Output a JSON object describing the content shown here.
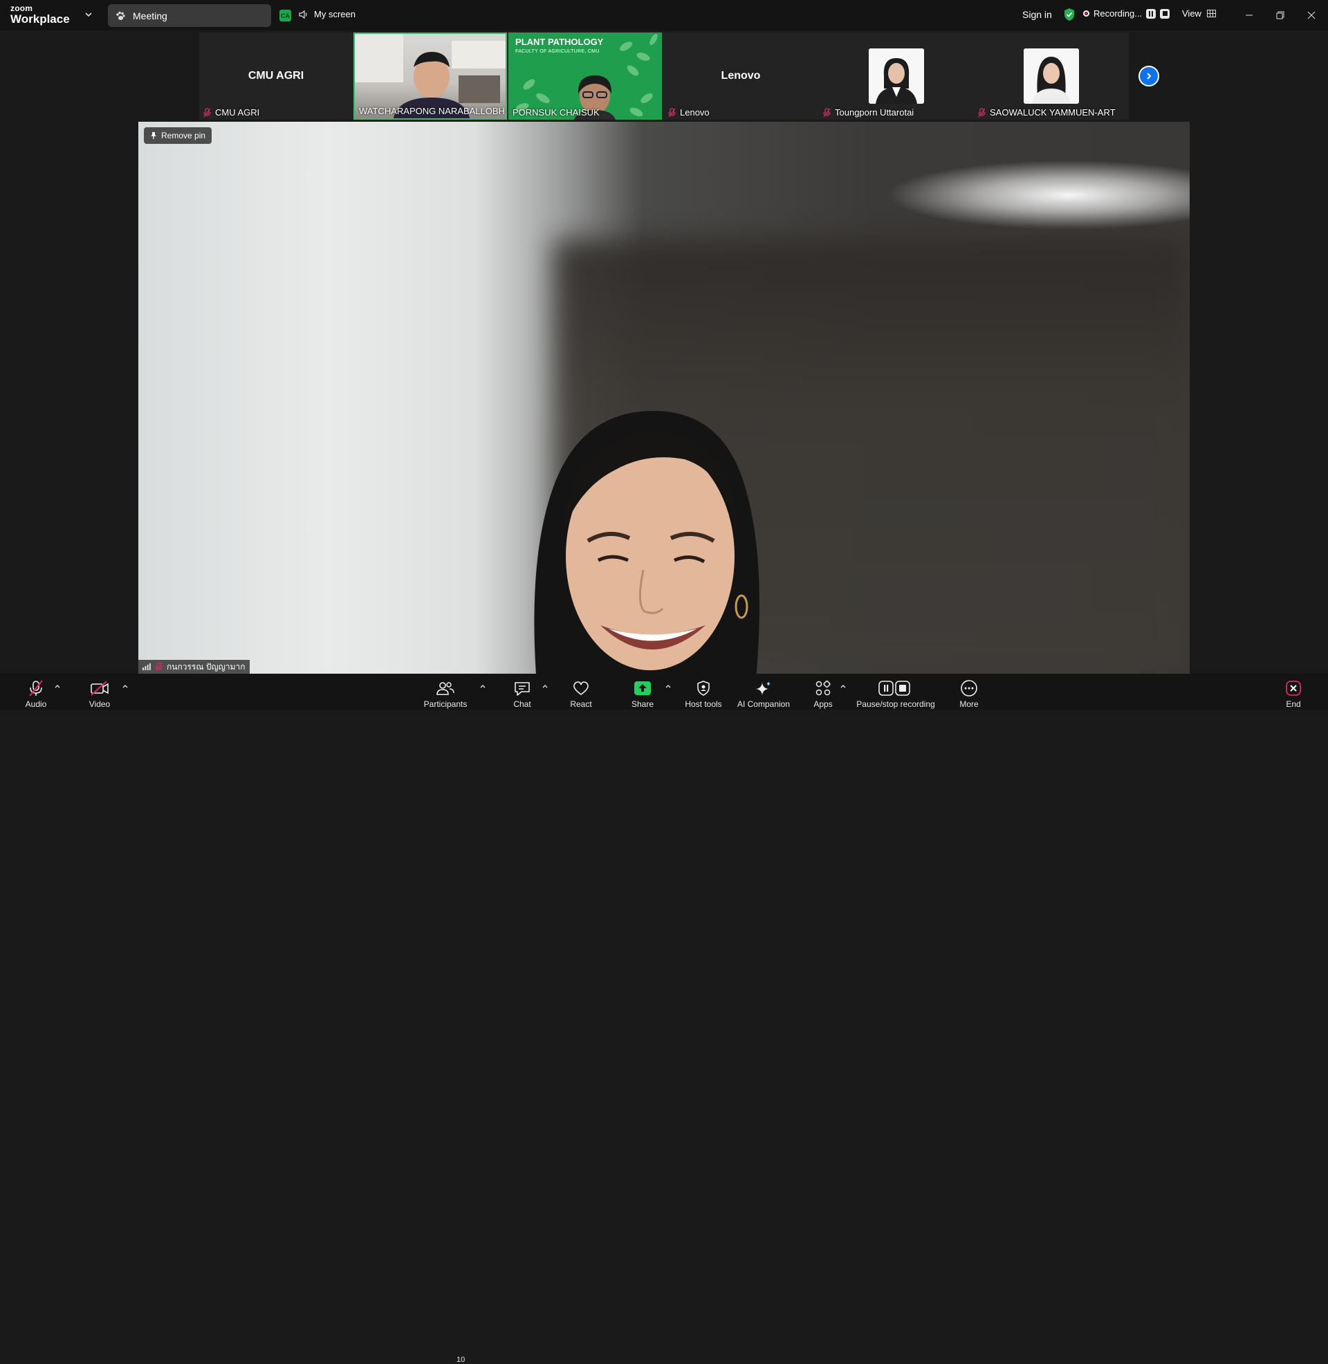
{
  "app": {
    "logo_small": "zoom",
    "logo_big": "Workplace"
  },
  "top": {
    "meeting_tab": "Meeting",
    "ca_badge": "CA",
    "my_screen": "My screen",
    "sign_in": "Sign in",
    "recording": "Recording...",
    "view": "View"
  },
  "participants_strip": [
    {
      "name": "CMU AGRI",
      "center": "CMU AGRI"
    },
    {
      "name": "WATCHARAPONG NARABALLOBH"
    },
    {
      "name": "PORNSUK CHAISUK",
      "banner_title": "PLANT PATHOLOGY",
      "banner_sub": "FACULTY OF AGRICULTURE, CMU"
    },
    {
      "name": "Lenovo",
      "center": "Lenovo"
    },
    {
      "name": "Toungporn Uttarotai"
    },
    {
      "name": "SAOWALUCK YAMMUEN-ART"
    }
  ],
  "main": {
    "remove_pin": "Remove pin",
    "speaker_name": "กนกวรรณ ปัญญามาก"
  },
  "toolbar": {
    "audio": "Audio",
    "video": "Video",
    "participants": "Participants",
    "participants_count": "10",
    "chat": "Chat",
    "react": "React",
    "share": "Share",
    "host_tools": "Host tools",
    "ai_companion": "AI Companion",
    "apps": "Apps",
    "pause_stop": "Pause/stop recording",
    "more": "More",
    "end": "End"
  },
  "colors": {
    "accent": "#0e72ed",
    "share": "#1fd15c",
    "active_speaker": "#27c66b",
    "end": "#e0245e",
    "muted": "#e0245e"
  },
  "icons": [
    "chevron-down-icon",
    "paw-icon",
    "speaker-icon",
    "shield-check-icon",
    "record-icon",
    "pause-icon",
    "stop-icon",
    "grid-icon",
    "minimize-icon",
    "restore-icon",
    "close-icon",
    "mic-off-icon",
    "pin-icon",
    "signal-icon",
    "chevron-right-icon",
    "video-off-icon",
    "people-icon",
    "chat-icon",
    "heart-icon",
    "share-up-icon",
    "shield-icon",
    "sparkle-icon",
    "apps-icon",
    "ellipsis-icon",
    "end-x-icon"
  ]
}
